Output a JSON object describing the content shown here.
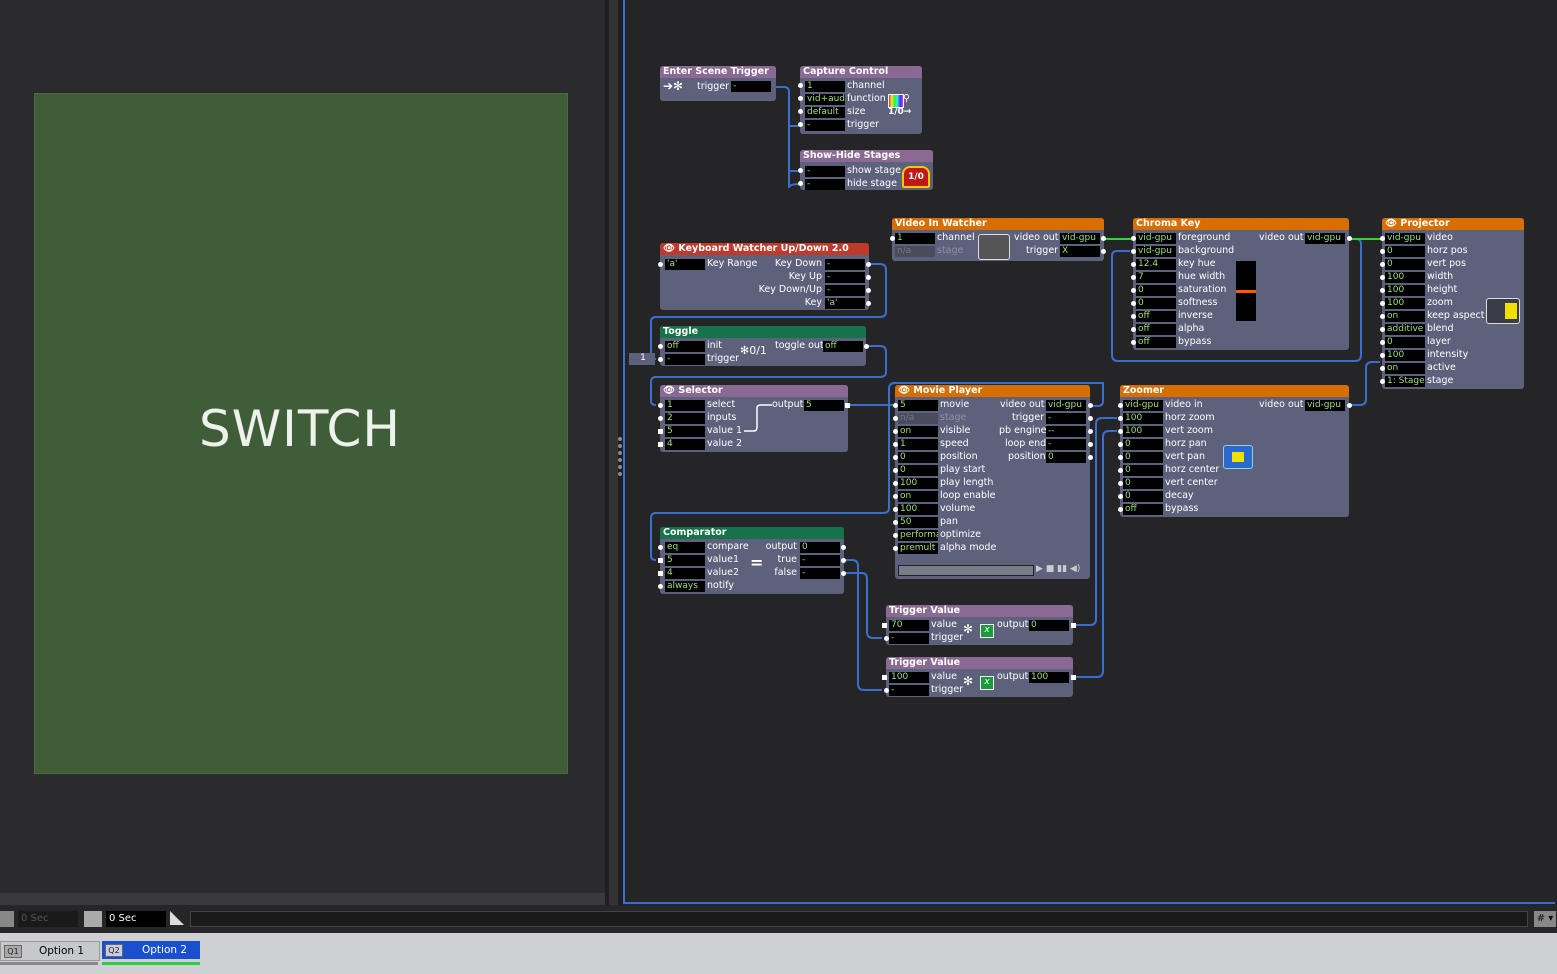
{
  "stage": {
    "text": "SWITCH"
  },
  "actors": {
    "enter_scene": {
      "title": "Enter Scene Trigger",
      "trigger_label": "trigger",
      "trigger_value": "-"
    },
    "capture": {
      "title": "Capture Control",
      "rows": [
        {
          "value": "1",
          "label": "channel"
        },
        {
          "value": "vid+aud",
          "label": "function"
        },
        {
          "value": "default",
          "label": "size"
        },
        {
          "value": "-",
          "label": "trigger"
        }
      ],
      "icon_text": "1/0→"
    },
    "show_hide": {
      "title": "Show-Hide Stages",
      "rows": [
        {
          "value": "-",
          "label": "show stage"
        },
        {
          "value": "-",
          "label": "hide stage"
        }
      ],
      "icon_text": "1/0"
    },
    "keyboard": {
      "title": "Keyboard Watcher Up/Down 2.0",
      "key_range_value": "'a'",
      "key_range_label": "Key Range",
      "outputs": [
        {
          "label": "Key Down",
          "value": "-"
        },
        {
          "label": "Key Up",
          "value": "-"
        },
        {
          "label": "Key Down/Up",
          "value": "-"
        },
        {
          "label": "Key",
          "value": "'a'"
        }
      ]
    },
    "toggle": {
      "title": "Toggle",
      "init_value": "off",
      "init_label": "init",
      "trigger_value": "-",
      "trigger_label": "trigger",
      "out_label": "toggle out",
      "out_value": "off",
      "icon_text": "0/1",
      "ext_value": "1"
    },
    "selector": {
      "title": "Selector",
      "rows": [
        {
          "value": "1",
          "label": "select"
        },
        {
          "value": "2",
          "label": "inputs"
        },
        {
          "value": "5",
          "label": "value 1"
        },
        {
          "value": "4",
          "label": "value 2"
        }
      ],
      "out_label": "output",
      "out_value": "5"
    },
    "comparator": {
      "title": "Comparator",
      "rows": [
        {
          "value": "eq",
          "label": "compare"
        },
        {
          "value": "5",
          "label": "value1"
        },
        {
          "value": "4",
          "label": "value2"
        },
        {
          "value": "always",
          "label": "notify"
        }
      ],
      "outputs": [
        {
          "label": "output",
          "value": "0"
        },
        {
          "label": "true",
          "value": "-"
        },
        {
          "label": "false",
          "value": "-"
        }
      ],
      "icon_text": "="
    },
    "video_in": {
      "title": "Video In Watcher",
      "rows": [
        {
          "value": "1",
          "label": "channel"
        },
        {
          "value": "n/a",
          "label": "stage"
        }
      ],
      "outputs": [
        {
          "label": "video out",
          "value": "vid-gpu"
        },
        {
          "label": "trigger",
          "value": "X"
        }
      ]
    },
    "movie": {
      "title": "Movie Player",
      "rows": [
        {
          "value": "5",
          "label": "movie"
        },
        {
          "value": "n/a",
          "label": "stage"
        },
        {
          "value": "on",
          "label": "visible"
        },
        {
          "value": "1",
          "label": "speed"
        },
        {
          "value": "0",
          "label": "position"
        },
        {
          "value": "0",
          "label": "play start"
        },
        {
          "value": "100",
          "label": "play length"
        },
        {
          "value": "on",
          "label": "loop enable"
        },
        {
          "value": "100",
          "label": "volume"
        },
        {
          "value": "50",
          "label": "pan"
        },
        {
          "value": "performance",
          "label": "optimize"
        },
        {
          "value": "premult",
          "label": "alpha mode"
        }
      ],
      "outputs": [
        {
          "label": "video out",
          "value": "vid-gpu"
        },
        {
          "label": "trigger",
          "value": "-"
        },
        {
          "label": "pb engine",
          "value": "--"
        },
        {
          "label": "loop end",
          "value": "-"
        },
        {
          "label": "position",
          "value": "0"
        }
      ]
    },
    "chroma": {
      "title": "Chroma Key",
      "rows": [
        {
          "value": "vid-gpu",
          "label": "foreground"
        },
        {
          "value": "vid-gpu",
          "label": "background"
        },
        {
          "value": "12.4",
          "label": "key hue"
        },
        {
          "value": "7",
          "label": "hue width"
        },
        {
          "value": "0",
          "label": "saturation"
        },
        {
          "value": "0",
          "label": "softness"
        },
        {
          "value": "off",
          "label": "inverse"
        },
        {
          "value": "off",
          "label": "alpha"
        },
        {
          "value": "off",
          "label": "bypass"
        }
      ],
      "out_label": "video out",
      "out_value": "vid-gpu"
    },
    "zoomer": {
      "title": "Zoomer",
      "rows": [
        {
          "value": "vid-gpu",
          "label": "video in"
        },
        {
          "value": "100",
          "label": "horz zoom"
        },
        {
          "value": "100",
          "label": "vert zoom"
        },
        {
          "value": "0",
          "label": "horz pan"
        },
        {
          "value": "0",
          "label": "vert pan"
        },
        {
          "value": "0",
          "label": "horz center"
        },
        {
          "value": "0",
          "label": "vert center"
        },
        {
          "value": "0",
          "label": "decay"
        },
        {
          "value": "off",
          "label": "bypass"
        }
      ],
      "out_label": "video out",
      "out_value": "vid-gpu"
    },
    "projector": {
      "title": "Projector",
      "rows": [
        {
          "value": "vid-gpu",
          "label": "video"
        },
        {
          "value": "0",
          "label": "horz pos"
        },
        {
          "value": "0",
          "label": "vert pos"
        },
        {
          "value": "100",
          "label": "width"
        },
        {
          "value": "100",
          "label": "height"
        },
        {
          "value": "100",
          "label": "zoom"
        },
        {
          "value": "on",
          "label": "keep aspect"
        },
        {
          "value": "additive",
          "label": "blend"
        },
        {
          "value": "0",
          "label": "layer"
        },
        {
          "value": "100",
          "label": "intensity"
        },
        {
          "value": "on",
          "label": "active"
        },
        {
          "value": "1: Stage",
          "label": "stage"
        }
      ]
    },
    "trigger_value_1": {
      "title": "Trigger Value",
      "value": "70",
      "value_label": "value",
      "trigger_value": "-",
      "trigger_label": "trigger",
      "out_label": "output",
      "out_value": "0"
    },
    "trigger_value_2": {
      "title": "Trigger Value",
      "value": "100",
      "value_label": "value",
      "trigger_value": "-",
      "trigger_label": "trigger",
      "out_label": "output",
      "out_value": "100"
    }
  },
  "transport": {
    "time_left": "0 Sec",
    "time_main": "0 Sec",
    "hash": "#"
  },
  "scenes": [
    {
      "num": "Q1",
      "label": "Option 1",
      "active": false
    },
    {
      "num": "Q2",
      "label": "Option 2",
      "active": true
    }
  ],
  "colors": {
    "wire": "#3a6fd0",
    "wire_active": "#3ccf3c",
    "stage_green": "#3f5e38",
    "movie_header": "#d66f00",
    "selected_scene": "#1a4fd0"
  }
}
